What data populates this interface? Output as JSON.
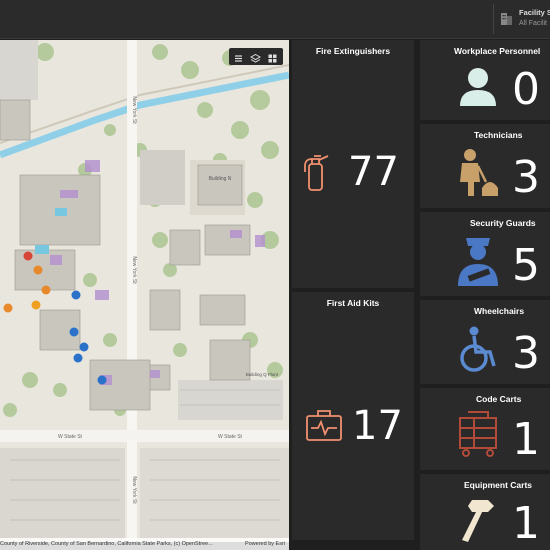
{
  "header": {
    "facility_selector_title": "Facility S",
    "facility_selector_value": "All Facilit",
    "facility_icon": "building-icon"
  },
  "map": {
    "labels": {
      "building_n": "Building N",
      "building_q": "Building Q Plant",
      "new_york_st_1": "New York St",
      "new_york_st_2": "New York St",
      "w_state_st_1": "W State St",
      "w_state_st_2": "W State St",
      "new_york_st_3": "New York St"
    },
    "tools": [
      "list-icon",
      "layers-icon",
      "grid-icon"
    ],
    "attribution": "County of Riverside, County of San Bernardino, California State Parks, (c) OpenStree...",
    "powered_by": "Powered by Esri"
  },
  "indicators": {
    "fire_extinguishers": {
      "title": "Fire Extinguishers",
      "value": "77",
      "icon": "fire-extinguisher-icon"
    },
    "first_aid_kits": {
      "title": "First Aid Kits",
      "value": "17",
      "icon": "first-aid-kit-icon"
    },
    "workplace_personnel": {
      "title": "Workplace Personnel",
      "value": "0",
      "icon": "person-icon"
    },
    "technicians": {
      "title": "Technicians",
      "value": "3",
      "icon": "technician-icon"
    },
    "security_guards": {
      "title": "Security Guards",
      "value": "5",
      "icon": "security-guard-icon"
    },
    "wheelchairs": {
      "title": "Wheelchairs",
      "value": "3",
      "icon": "wheelchair-icon"
    },
    "code_carts": {
      "title": "Code Carts",
      "value": "1",
      "icon": "code-cart-icon"
    },
    "equipment_carts": {
      "title": "Equipment Carts",
      "value": "1",
      "icon": "hammer-icon"
    }
  },
  "colors": {
    "fire": "#f0906e",
    "first_aid": "#f0906e",
    "personnel": "#d9eee9",
    "technician": "#c8a06a",
    "security": "#4a78c5",
    "wheelchair": "#5a8ad0",
    "code_cart": "#b24a3a",
    "equipment": "#f1e6cf"
  }
}
